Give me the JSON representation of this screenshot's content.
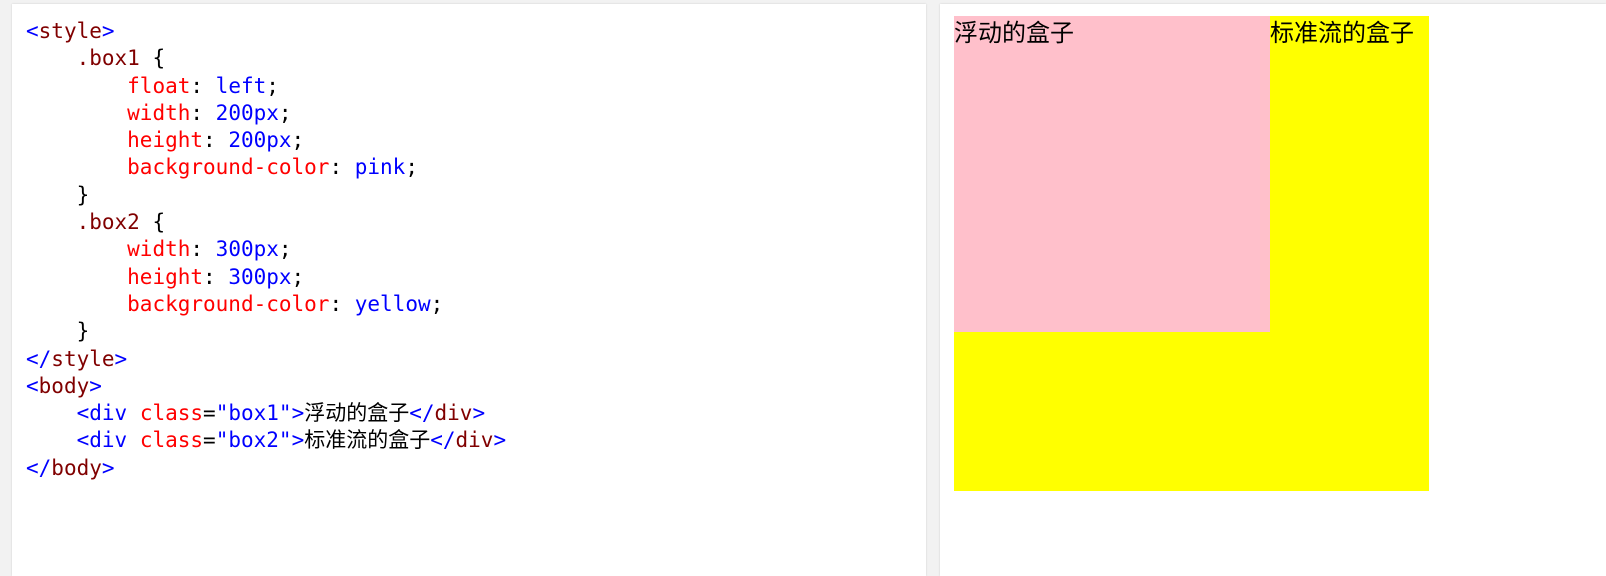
{
  "code": {
    "lines": [
      [
        {
          "t": "<",
          "c": "bracket"
        },
        {
          "t": "style",
          "c": "tag"
        },
        {
          "t": ">",
          "c": "bracket"
        }
      ],
      [
        {
          "t": "    ",
          "c": "plain"
        },
        {
          "t": ".box1",
          "c": "sel"
        },
        {
          "t": " {",
          "c": "plain"
        }
      ],
      [
        {
          "t": "        ",
          "c": "plain"
        },
        {
          "t": "float",
          "c": "prop"
        },
        {
          "t": ": ",
          "c": "plain"
        },
        {
          "t": "left",
          "c": "val"
        },
        {
          "t": ";",
          "c": "plain"
        }
      ],
      [
        {
          "t": "        ",
          "c": "plain"
        },
        {
          "t": "width",
          "c": "prop"
        },
        {
          "t": ": ",
          "c": "plain"
        },
        {
          "t": "200px",
          "c": "val"
        },
        {
          "t": ";",
          "c": "plain"
        }
      ],
      [
        {
          "t": "        ",
          "c": "plain"
        },
        {
          "t": "height",
          "c": "prop"
        },
        {
          "t": ": ",
          "c": "plain"
        },
        {
          "t": "200px",
          "c": "val"
        },
        {
          "t": ";",
          "c": "plain"
        }
      ],
      [
        {
          "t": "        ",
          "c": "plain"
        },
        {
          "t": "background-color",
          "c": "prop"
        },
        {
          "t": ": ",
          "c": "plain"
        },
        {
          "t": "pink",
          "c": "val"
        },
        {
          "t": ";",
          "c": "plain"
        }
      ],
      [
        {
          "t": "    }",
          "c": "plain"
        }
      ],
      [
        {
          "t": "    ",
          "c": "plain"
        },
        {
          "t": ".box2",
          "c": "sel"
        },
        {
          "t": " {",
          "c": "plain"
        }
      ],
      [
        {
          "t": "        ",
          "c": "plain"
        },
        {
          "t": "width",
          "c": "prop"
        },
        {
          "t": ": ",
          "c": "plain"
        },
        {
          "t": "300px",
          "c": "val"
        },
        {
          "t": ";",
          "c": "plain"
        }
      ],
      [
        {
          "t": "        ",
          "c": "plain"
        },
        {
          "t": "height",
          "c": "prop"
        },
        {
          "t": ": ",
          "c": "plain"
        },
        {
          "t": "300px",
          "c": "val"
        },
        {
          "t": ";",
          "c": "plain"
        }
      ],
      [
        {
          "t": "        ",
          "c": "plain"
        },
        {
          "t": "background-color",
          "c": "prop"
        },
        {
          "t": ": ",
          "c": "plain"
        },
        {
          "t": "yellow",
          "c": "val"
        },
        {
          "t": ";",
          "c": "plain"
        }
      ],
      [
        {
          "t": "    }",
          "c": "plain"
        }
      ],
      [
        {
          "t": "</",
          "c": "bracket"
        },
        {
          "t": "style",
          "c": "tag"
        },
        {
          "t": ">",
          "c": "bracket"
        }
      ],
      [
        {
          "t": "<",
          "c": "bracket"
        },
        {
          "t": "body",
          "c": "tag"
        },
        {
          "t": ">",
          "c": "bracket"
        }
      ],
      [
        {
          "t": "    ",
          "c": "plain"
        },
        {
          "t": "<",
          "c": "bracket"
        },
        {
          "t": "div",
          "c": "bracket"
        },
        {
          "t": " ",
          "c": "plain"
        },
        {
          "t": "class",
          "c": "attr"
        },
        {
          "t": "=",
          "c": "plain"
        },
        {
          "t": "\"box1\"",
          "c": "str"
        },
        {
          "t": ">",
          "c": "bracket"
        },
        {
          "t": "浮动的盒子",
          "c": "plain"
        },
        {
          "t": "</",
          "c": "bracket"
        },
        {
          "t": "div",
          "c": "tag"
        },
        {
          "t": ">",
          "c": "bracket"
        }
      ],
      [
        {
          "t": "    ",
          "c": "plain"
        },
        {
          "t": "<",
          "c": "bracket"
        },
        {
          "t": "div",
          "c": "bracket"
        },
        {
          "t": " ",
          "c": "plain"
        },
        {
          "t": "class",
          "c": "attr"
        },
        {
          "t": "=",
          "c": "plain"
        },
        {
          "t": "\"box2\"",
          "c": "str"
        },
        {
          "t": ">",
          "c": "bracket"
        },
        {
          "t": "标准流的盒子",
          "c": "plain"
        },
        {
          "t": "</",
          "c": "bracket"
        },
        {
          "t": "div",
          "c": "tag"
        },
        {
          "t": ">",
          "c": "bracket"
        }
      ],
      [
        {
          "t": "</",
          "c": "bracket"
        },
        {
          "t": "body",
          "c": "tag"
        },
        {
          "t": ">",
          "c": "bracket"
        }
      ]
    ]
  },
  "preview": {
    "box1_text": "浮动的盒子",
    "box2_text": "标准流的盒子",
    "box1_color": "#ffc0cb",
    "box2_color": "#ffff00"
  }
}
